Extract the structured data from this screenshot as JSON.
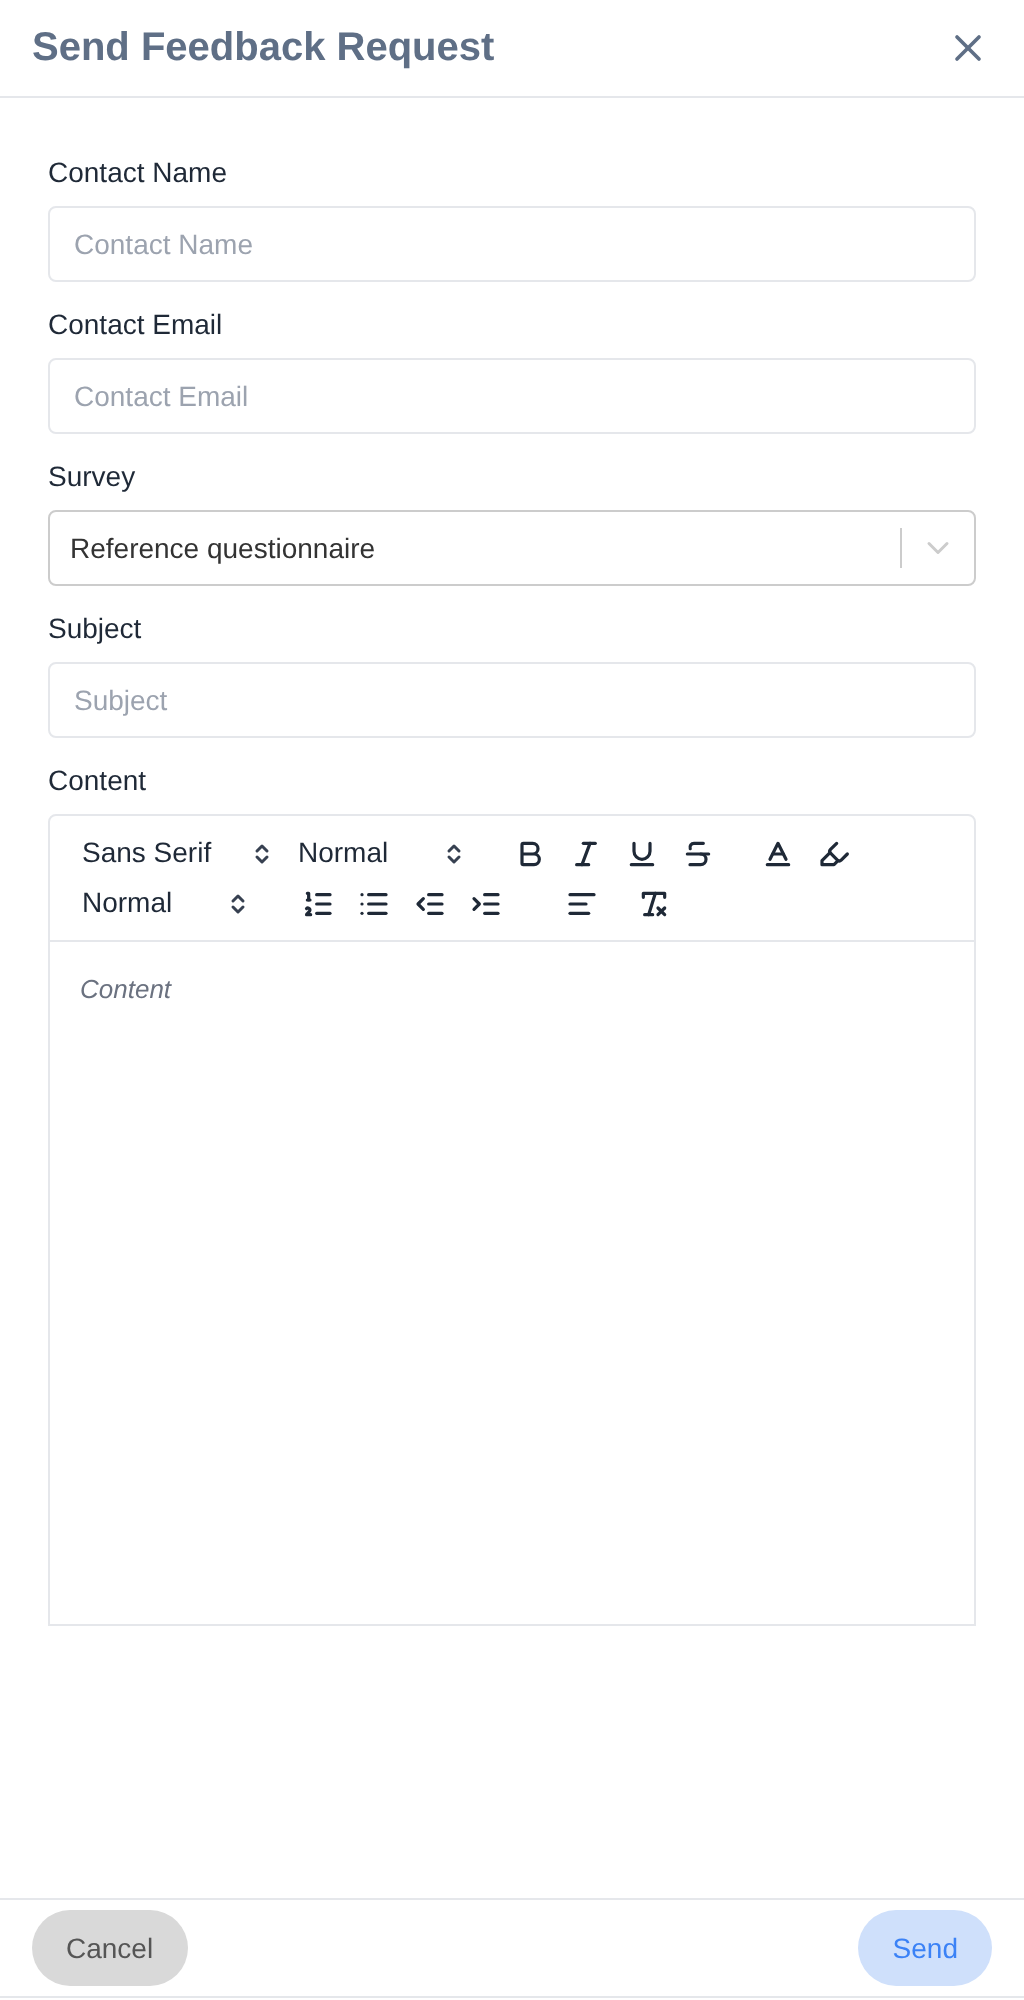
{
  "dialog": {
    "title": "Send Feedback Request"
  },
  "fields": [
    {
      "kind": "text",
      "label": "Contact Name",
      "placeholder": "Contact Name"
    },
    {
      "kind": "text",
      "label": "Contact Email",
      "placeholder": "Contact Email"
    },
    {
      "kind": "select",
      "label": "Survey",
      "value": "Reference questionnaire"
    },
    {
      "kind": "text",
      "label": "Subject",
      "placeholder": "Subject"
    }
  ],
  "editor": {
    "label": "Content",
    "font": "Sans Serif",
    "size": "Normal",
    "heading": "Normal",
    "placeholder": "Content"
  },
  "buttons": {
    "cancel": "Cancel",
    "send": "Send"
  }
}
